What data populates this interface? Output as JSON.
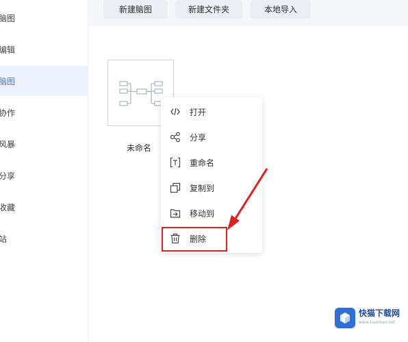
{
  "sidebar": {
    "items": [
      {
        "label": "脑图"
      },
      {
        "label": "编辑"
      },
      {
        "label": "脑图"
      },
      {
        "label": "协作"
      },
      {
        "label": "风暴"
      },
      {
        "label": "分享"
      },
      {
        "label": "收藏"
      },
      {
        "label": "站"
      }
    ]
  },
  "toolbar": {
    "new_mindmap": "新建脑图",
    "new_folder": "新建文件夹",
    "local_import": "本地导入"
  },
  "file": {
    "name": "未命名"
  },
  "context_menu": {
    "items": [
      {
        "label": "打开",
        "icon": "code-icon"
      },
      {
        "label": "分享",
        "icon": "share-icon"
      },
      {
        "label": "重命名",
        "icon": "rename-icon"
      },
      {
        "label": "复制到",
        "icon": "copy-icon"
      },
      {
        "label": "移动到",
        "icon": "move-icon"
      },
      {
        "label": "删除",
        "icon": "trash-icon"
      }
    ]
  },
  "watermark": {
    "title": "快猫下载网",
    "sub": "www.kuaimao.net"
  },
  "colors": {
    "accent": "#4a7cf7",
    "highlight": "#e02020"
  }
}
